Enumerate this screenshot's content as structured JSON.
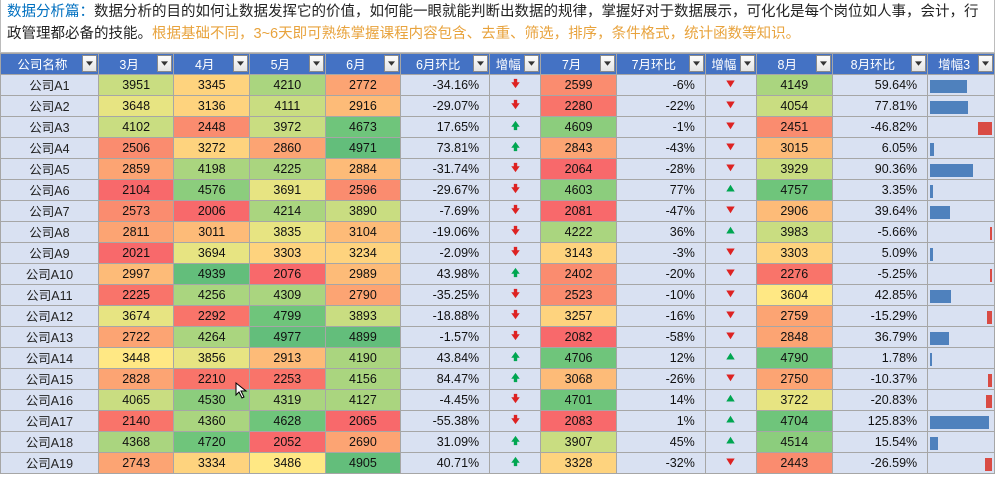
{
  "intro": {
    "lead": "数据分析篇：",
    "body": "数据分析的目的如何让数据发挥它的价值，如何能一眼就能判断出数据的规律，掌握好对于数据展示，可化化是每个岗位如人事，会计，行政管理都必备的技能。",
    "tail": "根据基础不同，3~6天即可熟练掌握课程内容包含、去重、筛选，排序，条件格式，统计函数等知识。"
  },
  "headers": [
    "公司名称",
    "3月",
    "4月",
    "5月",
    "6月",
    "6月环比",
    "增幅",
    "7月",
    "7月环比",
    "增幅",
    "8月",
    "8月环比",
    "增幅3"
  ],
  "rows": [
    {
      "name": "公司A1",
      "m3": 3951,
      "m4": 3345,
      "m5": 4210,
      "m6": 2772,
      "p6": "-34.16%",
      "a6": "d",
      "m7": 2599,
      "p7": "-6%",
      "a7": "d",
      "m8": 4149,
      "p8": "59.64%",
      "bar": 60
    },
    {
      "name": "公司A2",
      "m3": 3648,
      "m4": 3136,
      "m5": 4111,
      "m6": 2916,
      "p6": "-29.07%",
      "a6": "d",
      "m7": 2280,
      "p7": "-22%",
      "a7": "d",
      "m8": 4054,
      "p8": "77.81%",
      "bar": 62
    },
    {
      "name": "公司A3",
      "m3": 4102,
      "m4": 2448,
      "m5": 3972,
      "m6": 4673,
      "p6": "17.65%",
      "a6": "u",
      "m7": 4609,
      "p7": "-1%",
      "a7": "d",
      "m8": 2451,
      "p8": "-46.82%",
      "bar": -22
    },
    {
      "name": "公司A4",
      "m3": 2506,
      "m4": 3272,
      "m5": 2860,
      "m6": 4971,
      "p6": "73.81%",
      "a6": "u",
      "m7": 2843,
      "p7": "-43%",
      "a7": "d",
      "m8": 3015,
      "p8": "6.05%",
      "bar": 6
    },
    {
      "name": "公司A5",
      "m3": 2859,
      "m4": 4198,
      "m5": 4225,
      "m6": 2884,
      "p6": "-31.74%",
      "a6": "d",
      "m7": 2064,
      "p7": "-28%",
      "a7": "d",
      "m8": 3929,
      "p8": "90.36%",
      "bar": 70
    },
    {
      "name": "公司A6",
      "m3": 2104,
      "m4": 4576,
      "m5": 3691,
      "m6": 2596,
      "p6": "-29.67%",
      "a6": "d",
      "m7": 4603,
      "p7": "77%",
      "a7": "u",
      "m8": 4757,
      "p8": "3.35%",
      "bar": 4
    },
    {
      "name": "公司A7",
      "m3": 2573,
      "m4": 2006,
      "m5": 4214,
      "m6": 3890,
      "p6": "-7.69%",
      "a6": "d",
      "m7": 2081,
      "p7": "-47%",
      "a7": "d",
      "m8": 2906,
      "p8": "39.64%",
      "bar": 32
    },
    {
      "name": "公司A8",
      "m3": 2811,
      "m4": 3011,
      "m5": 3835,
      "m6": 3104,
      "p6": "-19.06%",
      "a6": "d",
      "m7": 4222,
      "p7": "36%",
      "a7": "u",
      "m8": 3983,
      "p8": "-5.66%",
      "bar": -4
    },
    {
      "name": "公司A9",
      "m3": 2021,
      "m4": 3694,
      "m5": 3303,
      "m6": 3234,
      "p6": "-2.09%",
      "a6": "d",
      "m7": 3143,
      "p7": "-3%",
      "a7": "d",
      "m8": 3303,
      "p8": "5.09%",
      "bar": 5
    },
    {
      "name": "公司A10",
      "m3": 2997,
      "m4": 4939,
      "m5": 2076,
      "m6": 2989,
      "p6": "43.98%",
      "a6": "u",
      "m7": 2402,
      "p7": "-20%",
      "a7": "d",
      "m8": 2276,
      "p8": "-5.25%",
      "bar": -4
    },
    {
      "name": "公司A11",
      "m3": 2225,
      "m4": 4256,
      "m5": 4309,
      "m6": 2790,
      "p6": "-35.25%",
      "a6": "d",
      "m7": 2523,
      "p7": "-10%",
      "a7": "d",
      "m8": 3604,
      "p8": "42.85%",
      "bar": 34
    },
    {
      "name": "公司A12",
      "m3": 3674,
      "m4": 2292,
      "m5": 4799,
      "m6": 3893,
      "p6": "-18.88%",
      "a6": "d",
      "m7": 3257,
      "p7": "-16%",
      "a7": "d",
      "m8": 2759,
      "p8": "-15.29%",
      "bar": -8
    },
    {
      "name": "公司A13",
      "m3": 2722,
      "m4": 4264,
      "m5": 4977,
      "m6": 4899,
      "p6": "-1.57%",
      "a6": "d",
      "m7": 2082,
      "p7": "-58%",
      "a7": "d",
      "m8": 2848,
      "p8": "36.79%",
      "bar": 30
    },
    {
      "name": "公司A14",
      "m3": 3448,
      "m4": 3856,
      "m5": 2913,
      "m6": 4190,
      "p6": "43.84%",
      "a6": "u",
      "m7": 4706,
      "p7": "12%",
      "a7": "u",
      "m8": 4790,
      "p8": "1.78%",
      "bar": 3
    },
    {
      "name": "公司A15",
      "m3": 2828,
      "m4": 2210,
      "m5": 2253,
      "m6": 4156,
      "p6": "84.47%",
      "a6": "u",
      "m7": 3068,
      "p7": "-26%",
      "a7": "d",
      "m8": 2750,
      "p8": "-10.37%",
      "bar": -6
    },
    {
      "name": "公司A16",
      "m3": 4065,
      "m4": 4530,
      "m5": 4319,
      "m6": 4127,
      "p6": "-4.45%",
      "a6": "d",
      "m7": 4701,
      "p7": "14%",
      "a7": "u",
      "m8": 3722,
      "p8": "-20.83%",
      "bar": -10
    },
    {
      "name": "公司A17",
      "m3": 2140,
      "m4": 4360,
      "m5": 4628,
      "m6": 2065,
      "p6": "-55.38%",
      "a6": "d",
      "m7": 2083,
      "p7": "1%",
      "a7": "u",
      "m8": 4704,
      "p8": "125.83%",
      "bar": 95
    },
    {
      "name": "公司A18",
      "m3": 4368,
      "m4": 4720,
      "m5": 2052,
      "m6": 2690,
      "p6": "31.09%",
      "a6": "u",
      "m7": 3907,
      "p7": "45%",
      "a7": "u",
      "m8": 4514,
      "p8": "15.54%",
      "bar": 13
    },
    {
      "name": "公司A19",
      "m3": 2743,
      "m4": 3334,
      "m5": 3486,
      "m6": 4905,
      "p6": "40.71%",
      "a6": "u",
      "m7": 3328,
      "p7": "-32%",
      "a7": "d",
      "m8": 2443,
      "p8": "-26.59%",
      "bar": -12
    }
  ],
  "widths": [
    88,
    68,
    68,
    68,
    68,
    80,
    46,
    68,
    80,
    46,
    68,
    86,
    60
  ],
  "min": 2000,
  "max": 5000
}
